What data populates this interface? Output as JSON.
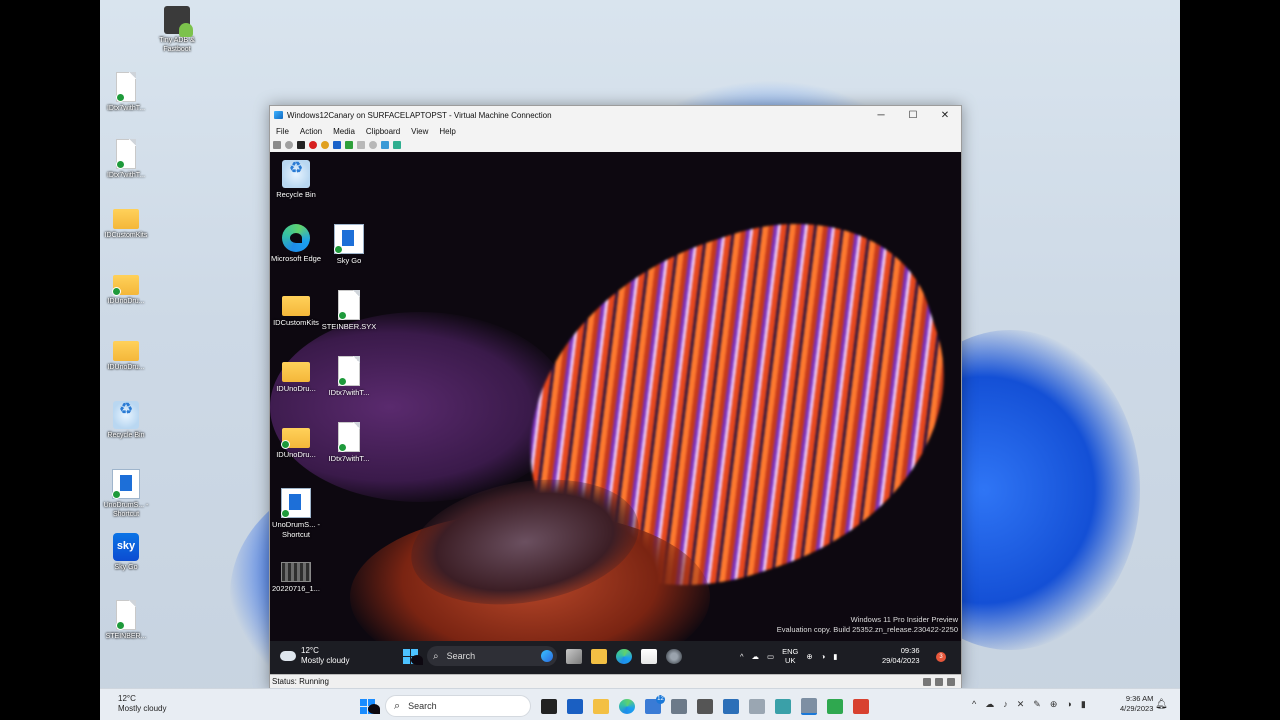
{
  "host": {
    "desktop_icons": [
      {
        "label": "Tiny ADB & Fastboot",
        "icon": "adb-icon"
      },
      {
        "label": "IDtx7withT...",
        "icon": "file-icon"
      },
      {
        "label": "IDtx7withT...",
        "icon": "audio-file-icon"
      },
      {
        "label": "IDCustomKits",
        "icon": "folder-icon"
      },
      {
        "label": "IDUnoDru...",
        "icon": "folder-icon"
      },
      {
        "label": "IDUnoDru...",
        "icon": "folder-icon"
      },
      {
        "label": "Recycle Bin",
        "icon": "recycle-bin-icon"
      },
      {
        "label": "UnoDrumS... - Shortcut",
        "icon": "shortcut-icon"
      },
      {
        "label": "Sky Go",
        "icon": "sky-go-icon"
      },
      {
        "label": "STEINBER...",
        "icon": "file-icon"
      }
    ],
    "taskbar": {
      "weather_temp": "12°C",
      "weather_desc": "Mostly cloudy",
      "search_label": "Search",
      "time": "9:36 AM",
      "date": "4/29/2023",
      "teams_badge": "12"
    }
  },
  "vm": {
    "title": "Windows12Canary on SURFACELAPTOPST - Virtual Machine Connection",
    "menu": [
      "File",
      "Action",
      "Media",
      "Clipboard",
      "View",
      "Help"
    ],
    "status": "Status: Running"
  },
  "guest": {
    "desktop_icons": [
      {
        "label": "Recycle Bin",
        "icon": "recycle-bin-icon"
      },
      {
        "label": "Microsoft Edge",
        "icon": "edge-icon"
      },
      {
        "label": "Sky Go",
        "icon": "sky-go-icon"
      },
      {
        "label": "IDCustomKits",
        "icon": "folder-icon"
      },
      {
        "label": "STEINBER.SYX",
        "icon": "file-icon"
      },
      {
        "label": "IDUnoDru...",
        "icon": "folder-icon"
      },
      {
        "label": "IDtx7withT...",
        "icon": "audio-file-icon"
      },
      {
        "label": "IDUnoDru...",
        "icon": "folder-icon"
      },
      {
        "label": "IDtx7withT...",
        "icon": "file-icon"
      },
      {
        "label": "UnoDrumS... - Shortcut",
        "icon": "shortcut-icon"
      },
      {
        "label": "20220716_1...",
        "icon": "video-icon"
      }
    ],
    "watermark_line1": "Windows 11 Pro Insider Preview",
    "watermark_line2": "Evaluation copy. Build 25352.zn_release.230422-2250",
    "taskbar": {
      "weather_temp": "12°C",
      "weather_desc": "Mostly cloudy",
      "search_label": "Search",
      "lang_line1": "ENG",
      "lang_line2": "UK",
      "time": "09:36",
      "date": "29/04/2023",
      "notification_count": "3"
    }
  }
}
